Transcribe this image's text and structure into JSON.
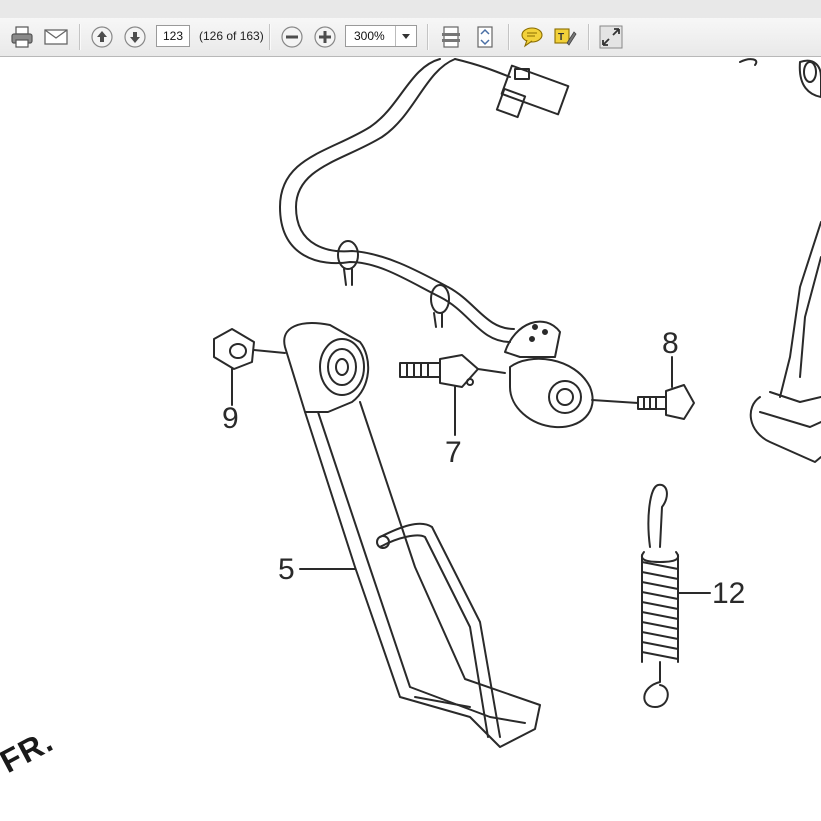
{
  "toolbar": {
    "print_icon": "printer-icon",
    "email_icon": "envelope-icon",
    "prev_icon": "arrow-up-icon",
    "next_icon": "arrow-down-icon",
    "page_number": "123",
    "page_count": "(126 of 163)",
    "zoom_out_icon": "minus-circle-icon",
    "zoom_in_icon": "plus-circle-icon",
    "zoom_value": "300%",
    "fit_page_icon": "fit-page-icon",
    "fit_width_icon": "fit-width-icon",
    "comment_icon": "speech-bubble-icon",
    "highlight_icon": "text-highlight-icon",
    "fullscreen_icon": "expand-icon"
  },
  "diagram": {
    "callouts": {
      "part_5": "5",
      "part_7": "7",
      "part_8": "8",
      "part_9": "9",
      "part_12": "12"
    },
    "watermark": "FR."
  },
  "colors": {
    "line": "#2a2a2a",
    "toolbar_bg": "#efefef",
    "icon_blue": "#4a6fa5",
    "icon_yellow": "#f2d13a"
  }
}
